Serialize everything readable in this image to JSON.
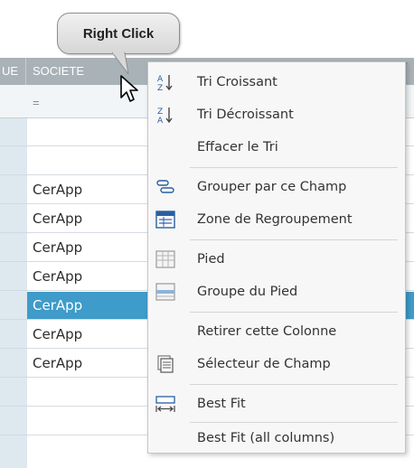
{
  "tooltip": {
    "text": "Right Click"
  },
  "grid": {
    "columns": [
      {
        "label": "UE"
      },
      {
        "label": "SOCIETE"
      }
    ],
    "filter_operator": "=",
    "rows": [
      {
        "value": ""
      },
      {
        "value": ""
      },
      {
        "value": "CerApp"
      },
      {
        "value": "CerApp"
      },
      {
        "value": "CerApp"
      },
      {
        "value": "CerApp"
      },
      {
        "value": "CerApp",
        "selected": true
      },
      {
        "value": "CerApp"
      },
      {
        "value": "CerApp"
      },
      {
        "value": ""
      },
      {
        "value": ""
      }
    ],
    "selection_color": "#3f9bc9",
    "header_color": "#a9b2b7"
  },
  "context_menu": {
    "items": [
      {
        "label": "Tri Croissant",
        "icon": "sort-ascending-icon"
      },
      {
        "label": "Tri Décroissant",
        "icon": "sort-descending-icon"
      },
      {
        "label": "Effacer le Tri",
        "icon": ""
      },
      {
        "label": "Grouper par ce Champ",
        "icon": "group-by-field-icon"
      },
      {
        "label": "Zone de Regroupement",
        "icon": "group-panel-icon"
      },
      {
        "label": "Pied",
        "icon": "footer-icon"
      },
      {
        "label": "Groupe du Pied",
        "icon": "group-footer-icon"
      },
      {
        "label": "Retirer cette Colonne",
        "icon": ""
      },
      {
        "label": "Sélecteur de Champ",
        "icon": "field-chooser-icon"
      },
      {
        "label": "Best Fit",
        "icon": "best-fit-icon"
      },
      {
        "label": "Best Fit (all columns)",
        "icon": ""
      }
    ]
  }
}
